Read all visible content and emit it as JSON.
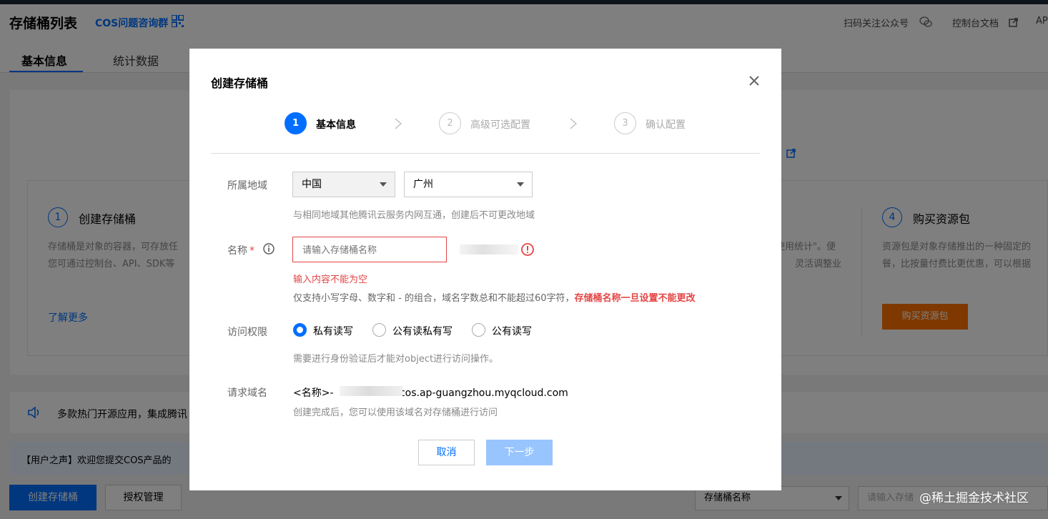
{
  "header": {
    "title": "存储桶列表",
    "cos_group_link": "COS问题咨询群",
    "follow_wechat": "扫码关注公众号",
    "console_docs": "控制台文档",
    "api_truncated": "AP"
  },
  "tabs": [
    {
      "label": "基本信息",
      "active": true
    },
    {
      "label": "统计数据",
      "active": false
    }
  ],
  "background": {
    "step1_title": "创建存储桶",
    "step1_desc_line1": "存储桶是对象的容器，可存放任",
    "step1_desc_line2": "您可通过控制台、API、SDK等",
    "learn_more": "了解更多",
    "step3_desc_fragment1": "使用统计\"。便",
    "step3_desc_fragment2": "灵活调整业",
    "step4_title": "购买资源包",
    "step4_desc_line1": "资源包是对象存储推出的一种固定的",
    "step4_desc_line2": "餐，比按量付费比更优惠，可以根据",
    "buy_button": "购买资源包",
    "notice_text": "多款热门开源应用，集成腾讯",
    "voice_text": "【用户之声】欢迎您提交COS产品的",
    "create_bucket_button": "创建存储桶",
    "auth_manage_button": "授权管理",
    "filter_select_value": "存储桶名称",
    "search_placeholder": "请输入存储",
    "watermark": "@稀土掘金技术社区"
  },
  "modal": {
    "title": "创建存储桶",
    "steps": [
      {
        "num": "1",
        "label": "基本信息",
        "active": true
      },
      {
        "num": "2",
        "label": "高级可选配置",
        "active": false
      },
      {
        "num": "3",
        "label": "确认配置",
        "active": false
      }
    ],
    "region": {
      "label": "所属地域",
      "country": "中国",
      "city": "广州",
      "hint": "与相同地域其他腾讯云服务内网互通，创建后不可更改地域"
    },
    "name": {
      "label": "名称",
      "required_mark": "*",
      "placeholder": "请输入存储桶名称",
      "error": "输入内容不能为空",
      "hint_prefix": "仅支持小写字母、数字和 - 的组合，域名字数总和不能超过60字符，",
      "hint_emphasis": "存储桶名称一旦设置不能更改"
    },
    "access": {
      "label": "访问权限",
      "options": [
        {
          "label": "私有读写",
          "checked": true
        },
        {
          "label": "公有读私有写",
          "checked": false
        },
        {
          "label": "公有读写",
          "checked": false
        }
      ],
      "hint": "需要进行身份验证后才能对object进行访问操作。"
    },
    "domain": {
      "label": "请求域名",
      "prefix": "<名称>-",
      "suffix": ".cos.ap-guangzhou.myqcloud.com",
      "hint": "创建完成后，您可以使用该域名对存储桶进行访问"
    },
    "buttons": {
      "cancel": "取消",
      "next": "下一步"
    }
  },
  "colors": {
    "primary": "#006eff",
    "error": "#e54545",
    "disabled_primary": "#99c5ff",
    "buy_orange": "#ff7200"
  }
}
